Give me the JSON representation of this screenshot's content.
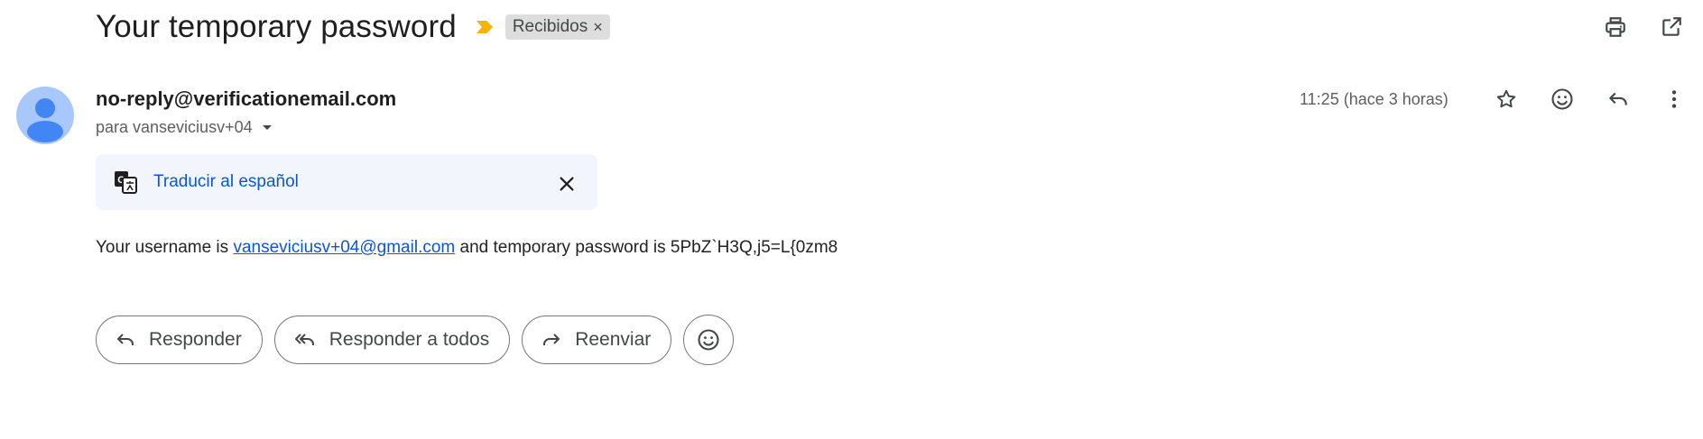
{
  "email": {
    "subject": "Your temporary password",
    "label": "Recibidos",
    "label_remove": "×",
    "sender": "no-reply@verificationemail.com",
    "recipient": "para vanseviciusv+04",
    "timestamp": "11:25 (hace 3 horas)",
    "translate_link": "Traducir al español",
    "body_prefix": "Your username is ",
    "body_link": "vanseviciusv+04@gmail.com",
    "body_suffix": " and temporary password is 5PbZ`H3Q,j5=L{0zm8"
  },
  "actions": {
    "reply": "Responder",
    "reply_all": "Responder a todos",
    "forward": "Reenviar"
  },
  "icons": {
    "importance": "importance-marker-icon",
    "print": "print-icon",
    "open_new": "open-in-new-window-icon",
    "star": "star-icon",
    "emoji": "emoji-reaction-icon",
    "reply": "reply-icon",
    "more": "more-vert-icon",
    "translate": "translate-icon",
    "close": "close-icon",
    "reply_all": "reply-all-icon",
    "forward": "forward-icon"
  },
  "colors": {
    "avatar_bg": "#a8c7fa",
    "avatar_fg": "#4285f4",
    "importance": "#f4b400",
    "link": "#0b57d0",
    "translate_bar_bg": "#f2f6fc",
    "label_chip_bg": "#dddddd"
  }
}
